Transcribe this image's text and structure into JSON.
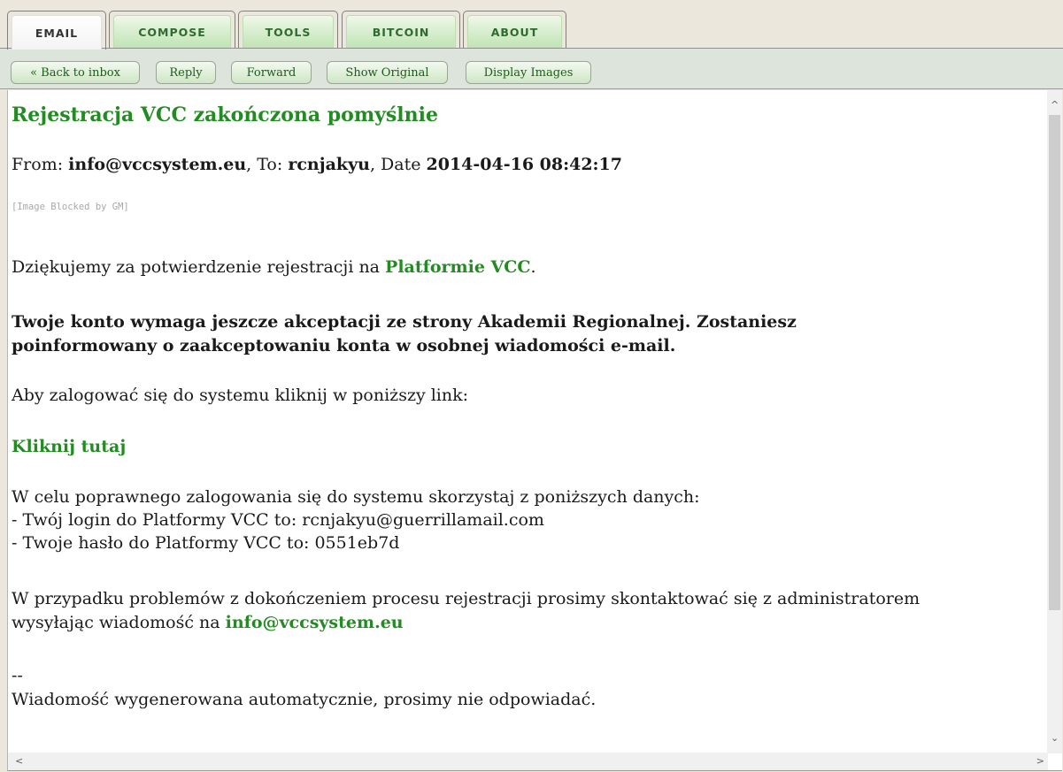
{
  "tabs": [
    {
      "label": "EMAIL",
      "active": true
    },
    {
      "label": "COMPOSE",
      "active": false
    },
    {
      "label": "TOOLS",
      "active": false
    },
    {
      "label": "BITCOIN",
      "active": false
    },
    {
      "label": "ABOUT",
      "active": false
    }
  ],
  "toolbar": {
    "back": "« Back to inbox",
    "reply": "Reply",
    "forward": "Forward",
    "show_original": "Show Original",
    "display_images": "Display Images"
  },
  "message": {
    "subject": "Rejestracja VCC zakończona pomyślnie",
    "from_label": "From: ",
    "from": "info@vccsystem.eu",
    "to_label": ", To: ",
    "to": "rcnjakyu",
    "date_label": ", Date ",
    "date": "2014-04-16 08:42:17",
    "image_blocked": "[Image Blocked by GM]",
    "para1_text": "Dziękujemy za potwierdzenie rejestracji na ",
    "para1_link": "Platformie VCC",
    "para1_end": ".",
    "para2_line1": "Twoje konto wymaga jeszcze akceptacji ze strony Akademii Regionalnej. Zostaniesz",
    "para2_line2": "poinformowany o zaakceptowaniu konta w osobnej wiadomości e-mail.",
    "para3": "Aby zalogować się do systemu kliknij w poniższy link:",
    "link_click": "Kliknij tutaj",
    "para4_line1": "W celu poprawnego zalogowania się do systemu skorzystaj z poniższych danych:",
    "para4_line2": "- Twój login do Platformy VCC to: rcnjakyu@guerrillamail.com",
    "para4_line3": "- Twoje hasło do Platformy VCC to: 0551eb7d",
    "para5_line1": "W przypadku problemów z dokończeniem procesu rejestracji prosimy skontaktować się z administratorem",
    "para5_line2_text": "wysyłając wiadomość na ",
    "para5_link": "info@vccsystem.eu",
    "sig_sep": "--",
    "sig": "Wiadomość wygenerowana automatycznie, prosimy nie odpowiadać."
  },
  "icons": {
    "scroll_up": "chevron-up-icon",
    "scroll_down": "chevron-down-icon",
    "scroll_left": "chevron-left-icon",
    "scroll_right": "chevron-right-icon"
  },
  "colors": {
    "accent_green": "#228b22",
    "tab_text": "#2f6b2f",
    "background": "#ece7dd"
  }
}
